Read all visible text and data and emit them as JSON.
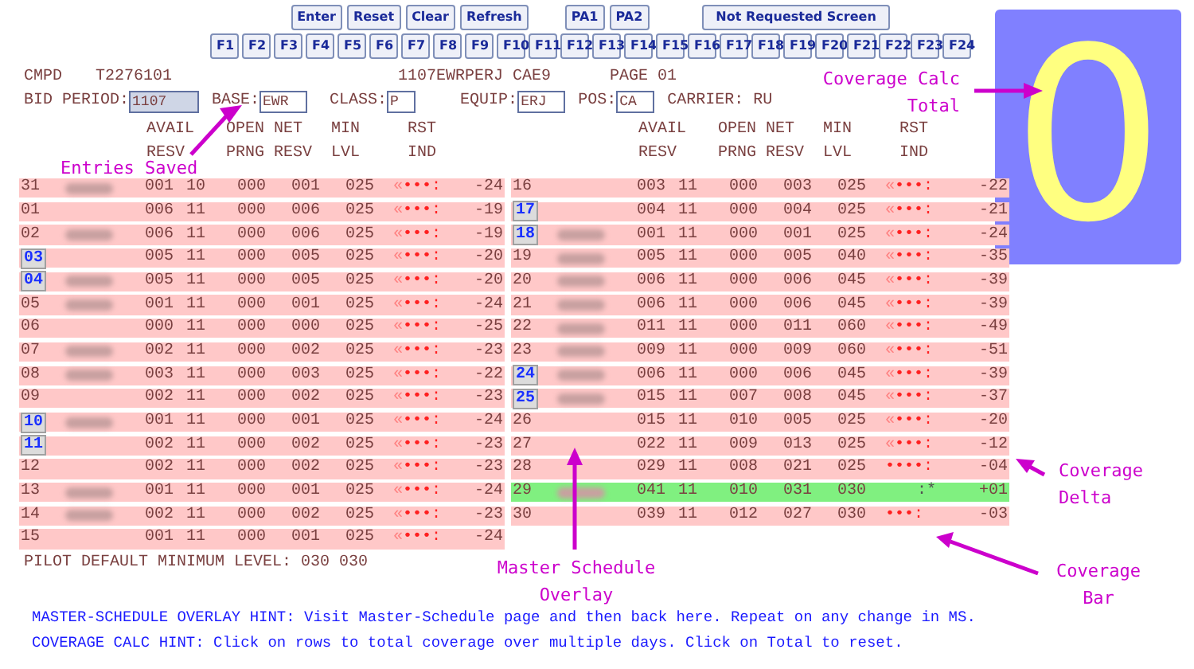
{
  "toolbar": {
    "buttons": [
      "Enter",
      "Reset",
      "Clear",
      "Refresh",
      "PA1",
      "PA2",
      "Not Requested Screen"
    ],
    "function_keys": [
      "F1",
      "F2",
      "F3",
      "F4",
      "F5",
      "F6",
      "F7",
      "F8",
      "F9",
      "F10",
      "F11",
      "F12",
      "F13",
      "F14",
      "F15",
      "F16",
      "F17",
      "F18",
      "F19",
      "F20",
      "F21",
      "F22",
      "F23",
      "F24"
    ]
  },
  "header": {
    "screen_id": "CMPD",
    "user_id": "T2276101",
    "record": "1107EWRPERJ CAE9",
    "page": "PAGE 01",
    "carrier": "CARRIER: RU"
  },
  "fields": [
    {
      "label": "BID PERIOD:",
      "value": "1107",
      "focused": true
    },
    {
      "label": "BASE:",
      "value": "EWR",
      "focused": false
    },
    {
      "label": "CLASS:",
      "value": "P",
      "focused": false
    },
    {
      "label": "EQUIP:",
      "value": "ERJ",
      "focused": false
    },
    {
      "label": "POS:",
      "value": "CA",
      "focused": false
    }
  ],
  "tables": [
    {
      "column_headers": [
        {
          "top": "AVAIL",
          "bottom": "RESV"
        },
        {
          "top": "OPEN",
          "bottom": "PRNG"
        },
        {
          "top": "NET",
          "bottom": "RESV"
        },
        {
          "top": "MIN",
          "bottom": "LVL"
        },
        {
          "top": "RST",
          "bottom": "IND"
        }
      ],
      "rows": [
        {
          "day": "31",
          "linked": false,
          "redacted": true,
          "highlight": false,
          "values": [
            "001",
            "10",
            "000",
            "001",
            "025"
          ],
          "bar_mark": "«",
          "bar": "•••:",
          "delta": "-24"
        },
        {
          "day": "01",
          "linked": false,
          "redacted": false,
          "highlight": false,
          "values": [
            "006",
            "11",
            "000",
            "006",
            "025"
          ],
          "bar_mark": "«",
          "bar": "•••:",
          "delta": "-19"
        },
        {
          "day": "02",
          "linked": false,
          "redacted": true,
          "highlight": false,
          "values": [
            "006",
            "11",
            "000",
            "006",
            "025"
          ],
          "bar_mark": "«",
          "bar": "•••:",
          "delta": "-19"
        },
        {
          "day": "03",
          "linked": true,
          "redacted": false,
          "highlight": false,
          "values": [
            "005",
            "11",
            "000",
            "005",
            "025"
          ],
          "bar_mark": "«",
          "bar": "•••:",
          "delta": "-20"
        },
        {
          "day": "04",
          "linked": true,
          "redacted": true,
          "highlight": false,
          "values": [
            "005",
            "11",
            "000",
            "005",
            "025"
          ],
          "bar_mark": "«",
          "bar": "•••:",
          "delta": "-20"
        },
        {
          "day": "05",
          "linked": false,
          "redacted": true,
          "highlight": false,
          "values": [
            "001",
            "11",
            "000",
            "001",
            "025"
          ],
          "bar_mark": "«",
          "bar": "•••:",
          "delta": "-24"
        },
        {
          "day": "06",
          "linked": false,
          "redacted": false,
          "highlight": false,
          "values": [
            "000",
            "11",
            "000",
            "000",
            "025"
          ],
          "bar_mark": "«",
          "bar": "•••:",
          "delta": "-25"
        },
        {
          "day": "07",
          "linked": false,
          "redacted": true,
          "highlight": false,
          "values": [
            "002",
            "11",
            "000",
            "002",
            "025"
          ],
          "bar_mark": "«",
          "bar": "•••:",
          "delta": "-23"
        },
        {
          "day": "08",
          "linked": false,
          "redacted": true,
          "highlight": false,
          "values": [
            "003",
            "11",
            "000",
            "003",
            "025"
          ],
          "bar_mark": "«",
          "bar": "•••:",
          "delta": "-22"
        },
        {
          "day": "09",
          "linked": false,
          "redacted": false,
          "highlight": false,
          "values": [
            "002",
            "11",
            "000",
            "002",
            "025"
          ],
          "bar_mark": "«",
          "bar": "•••:",
          "delta": "-23"
        },
        {
          "day": "10",
          "linked": true,
          "redacted": true,
          "highlight": false,
          "values": [
            "001",
            "11",
            "000",
            "001",
            "025"
          ],
          "bar_mark": "«",
          "bar": "•••:",
          "delta": "-24"
        },
        {
          "day": "11",
          "linked": true,
          "redacted": false,
          "highlight": false,
          "values": [
            "002",
            "11",
            "000",
            "002",
            "025"
          ],
          "bar_mark": "«",
          "bar": "•••:",
          "delta": "-23"
        },
        {
          "day": "12",
          "linked": false,
          "redacted": false,
          "highlight": false,
          "values": [
            "002",
            "11",
            "000",
            "002",
            "025"
          ],
          "bar_mark": "«",
          "bar": "•••:",
          "delta": "-23"
        },
        {
          "day": "13",
          "linked": false,
          "redacted": true,
          "highlight": false,
          "values": [
            "001",
            "11",
            "000",
            "001",
            "025"
          ],
          "bar_mark": "«",
          "bar": "•••:",
          "delta": "-24"
        },
        {
          "day": "14",
          "linked": false,
          "redacted": true,
          "highlight": false,
          "values": [
            "002",
            "11",
            "000",
            "002",
            "025"
          ],
          "bar_mark": "«",
          "bar": "•••:",
          "delta": "-23"
        },
        {
          "day": "15",
          "linked": false,
          "redacted": false,
          "highlight": false,
          "values": [
            "001",
            "11",
            "000",
            "001",
            "025"
          ],
          "bar_mark": "«",
          "bar": "•••:",
          "delta": "-24"
        }
      ]
    },
    {
      "column_headers": [
        {
          "top": "AVAIL",
          "bottom": "RESV"
        },
        {
          "top": "OPEN",
          "bottom": "PRNG"
        },
        {
          "top": "NET",
          "bottom": "RESV"
        },
        {
          "top": "MIN",
          "bottom": "LVL"
        },
        {
          "top": "RST",
          "bottom": "IND"
        }
      ],
      "rows": [
        {
          "day": "16",
          "linked": false,
          "redacted": false,
          "highlight": false,
          "values": [
            "003",
            "11",
            "000",
            "003",
            "025"
          ],
          "bar_mark": "«",
          "bar": "•••:",
          "delta": "-22"
        },
        {
          "day": "17",
          "linked": true,
          "redacted": false,
          "highlight": false,
          "values": [
            "004",
            "11",
            "000",
            "004",
            "025"
          ],
          "bar_mark": "«",
          "bar": "•••:",
          "delta": "-21"
        },
        {
          "day": "18",
          "linked": true,
          "redacted": true,
          "highlight": false,
          "values": [
            "001",
            "11",
            "000",
            "001",
            "025"
          ],
          "bar_mark": "«",
          "bar": "•••:",
          "delta": "-24"
        },
        {
          "day": "19",
          "linked": false,
          "redacted": true,
          "highlight": false,
          "values": [
            "005",
            "11",
            "000",
            "005",
            "040"
          ],
          "bar_mark": "«",
          "bar": "•••:",
          "delta": "-35"
        },
        {
          "day": "20",
          "linked": false,
          "redacted": true,
          "highlight": false,
          "values": [
            "006",
            "11",
            "000",
            "006",
            "045"
          ],
          "bar_mark": "«",
          "bar": "•••:",
          "delta": "-39"
        },
        {
          "day": "21",
          "linked": false,
          "redacted": true,
          "highlight": false,
          "values": [
            "006",
            "11",
            "000",
            "006",
            "045"
          ],
          "bar_mark": "«",
          "bar": "•••:",
          "delta": "-39"
        },
        {
          "day": "22",
          "linked": false,
          "redacted": true,
          "highlight": false,
          "values": [
            "011",
            "11",
            "000",
            "011",
            "060"
          ],
          "bar_mark": "«",
          "bar": "•••:",
          "delta": "-49"
        },
        {
          "day": "23",
          "linked": false,
          "redacted": true,
          "highlight": false,
          "values": [
            "009",
            "11",
            "000",
            "009",
            "060"
          ],
          "bar_mark": "«",
          "bar": "•••:",
          "delta": "-51"
        },
        {
          "day": "24",
          "linked": true,
          "redacted": true,
          "highlight": false,
          "values": [
            "006",
            "11",
            "000",
            "006",
            "045"
          ],
          "bar_mark": "«",
          "bar": "•••:",
          "delta": "-39"
        },
        {
          "day": "25",
          "linked": true,
          "redacted": true,
          "highlight": false,
          "values": [
            "015",
            "11",
            "007",
            "008",
            "045"
          ],
          "bar_mark": "«",
          "bar": "•••:",
          "delta": "-37"
        },
        {
          "day": "26",
          "linked": false,
          "redacted": false,
          "highlight": false,
          "values": [
            "015",
            "11",
            "010",
            "005",
            "025"
          ],
          "bar_mark": "«",
          "bar": "•••:",
          "delta": "-20"
        },
        {
          "day": "27",
          "linked": false,
          "redacted": false,
          "highlight": false,
          "values": [
            "022",
            "11",
            "009",
            "013",
            "025"
          ],
          "bar_mark": "«",
          "bar": "•••:",
          "delta": "-12"
        },
        {
          "day": "28",
          "linked": false,
          "redacted": false,
          "highlight": false,
          "values": [
            "029",
            "11",
            "008",
            "021",
            "025"
          ],
          "bar_mark": "",
          "bar": "••••:",
          "delta": "-04"
        },
        {
          "day": "29",
          "linked": false,
          "redacted": true,
          "highlight": true,
          "values": [
            "041",
            "11",
            "010",
            "031",
            "030"
          ],
          "bar_mark": "",
          "bar": ":*",
          "delta": "+01"
        },
        {
          "day": "30",
          "linked": false,
          "redacted": false,
          "highlight": false,
          "values": [
            "039",
            "11",
            "012",
            "027",
            "030"
          ],
          "bar_mark": "",
          "bar": "•••:",
          "delta": "-03"
        }
      ]
    }
  ],
  "default_level": "PILOT DEFAULT MINIMUM LEVEL: 030 030",
  "coverage_total": "0",
  "annotations": [
    "Entries Saved",
    "Coverage Calc Total",
    "Coverage Delta",
    "Master Schedule Overlay",
    "Coverage Bar"
  ],
  "hints": [
    "MASTER-SCHEDULE OVERLAY HINT: Visit Master-Schedule page and then back here. Repeat on any change in MS.",
    "COVERAGE CALC HINT: Click on rows to total coverage over multiple days. Click on Total to reset."
  ]
}
